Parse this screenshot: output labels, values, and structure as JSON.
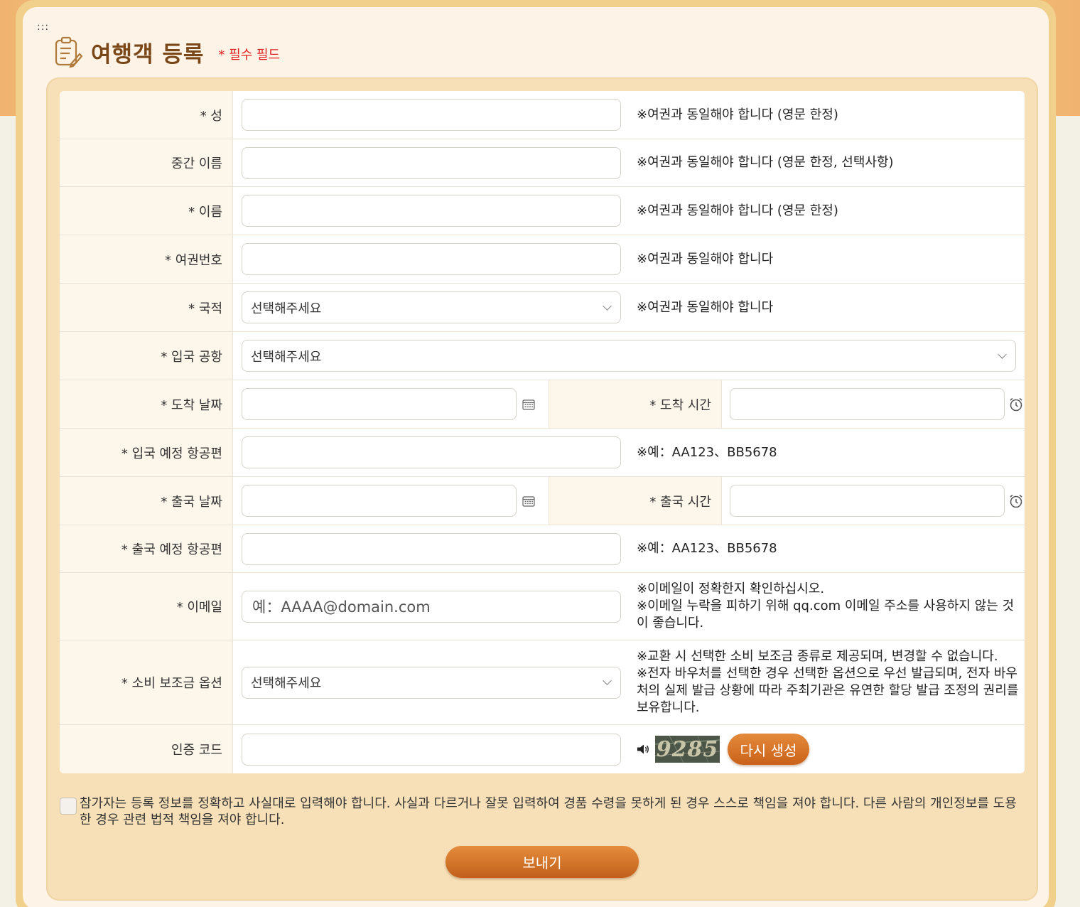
{
  "header": {
    "title": "여행객 등록",
    "required_note": "* 필수 필드",
    "drag_handle": ":::"
  },
  "form": {
    "surname": {
      "label": "* 성",
      "value": "",
      "note": "※여권과 동일해야 합니다 (영문 한정)"
    },
    "middle_name": {
      "label": "중간 이름",
      "value": "",
      "note": "※여권과 동일해야 합니다 (영문 한정, 선택사항)"
    },
    "given_name": {
      "label": "* 이름",
      "value": "",
      "note": "※여권과 동일해야 합니다 (영문 한정)"
    },
    "passport_no": {
      "label": "* 여권번호",
      "value": "",
      "note": "※여권과 동일해야 합니다"
    },
    "nationality": {
      "label": "* 국적",
      "selected": "선택해주세요",
      "note": "※여권과 동일해야 합니다"
    },
    "entry_airport": {
      "label": "* 입국 공항",
      "selected": "선택해주세요"
    },
    "arrival_date": {
      "label": "* 도착 날짜",
      "value": ""
    },
    "arrival_time": {
      "label": "* 도착 시간",
      "value": ""
    },
    "arrival_flight": {
      "label": "* 입국 예정 항공편",
      "value": "",
      "note": "※예：AA123、BB5678"
    },
    "departure_date": {
      "label": "* 출국 날짜",
      "value": ""
    },
    "departure_time": {
      "label": "* 출국 시간",
      "value": ""
    },
    "departure_flight": {
      "label": "* 출국 예정 항공편",
      "value": "",
      "note": "※예：AA123、BB5678"
    },
    "email": {
      "label": "* 이메일",
      "placeholder": "예：AAAA@domain.com",
      "note_line1": "※이메일이 정확한지 확인하십시오.",
      "note_line2": "※이메일 누락을 피하기 위해 qq.com 이메일 주소를 사용하지 않는 것이 좋습니다."
    },
    "subsidy": {
      "label": "* 소비 보조금 옵션",
      "selected": "선택해주세요",
      "note_line1": "※교환 시 선택한 소비 보조금 종류로 제공되며, 변경할 수 없습니다.",
      "note_line2": "※전자 바우처를 선택한 경우 선택한 옵션으로 우선 발급되며, 전자 바우처의 실제 발급 상황에 따라 주최기관은 유연한 할당 발급 조정의 권리를 보유합니다."
    },
    "captcha": {
      "label": "인증 코드",
      "value": "",
      "image_text": "9285",
      "regenerate_label": "다시 생성"
    }
  },
  "agreement": {
    "checked": false,
    "text": "참가자는 등록 정보를 정확하고 사실대로 입력해야 합니다. 사실과 다르거나 잘못 입력하여 경품 수령을 못하게 된 경우 스스로 책임을 져야 합니다. 다른 사람의 개인정보를 도용한 경우 관련 법적 책임을 져야 합니다."
  },
  "submit_label": "보내기",
  "colors": {
    "accent": "#d2701f",
    "title": "#7a4818",
    "required": "#e02020",
    "label_bg": "#fdf6ea",
    "panel_bg": "#f7e0b8"
  },
  "icons": [
    "document-edit-icon",
    "calendar-icon",
    "alarm-clock-icon",
    "speaker-icon",
    "chevron-down-icon"
  ]
}
